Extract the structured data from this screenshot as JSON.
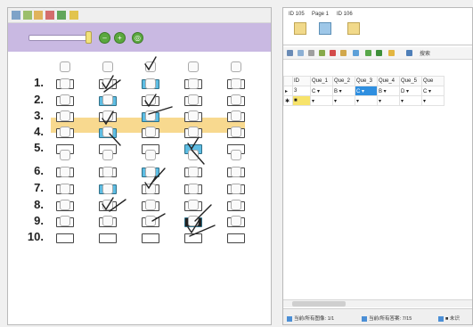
{
  "omr": {
    "questions": [
      "1.",
      "2.",
      "3.",
      "4.",
      "5.",
      "6.",
      "7.",
      "8.",
      "9.",
      "10."
    ]
  },
  "pages": {
    "items": [
      {
        "label": "ID 105"
      },
      {
        "label": "Page 1"
      },
      {
        "label": "ID 106"
      }
    ]
  },
  "grid": {
    "search_label": "搜索",
    "headers": [
      "",
      "ID",
      "Que_1",
      "Que_2",
      "Que_3",
      "Que_4",
      "Que_5",
      "Que"
    ],
    "rows": [
      [
        "▸",
        "3",
        "C  ▾",
        "B  ▾",
        "C  ▾",
        "B  ▾",
        "D  ▾",
        "C  ▾"
      ],
      [
        "✱",
        "■",
        "▾",
        "▾",
        "▾",
        "▾",
        "▾",
        "▾"
      ]
    ]
  },
  "status": {
    "item1": "当前/所有图像: 1/1",
    "item2": "当前/所有答案: 7/15",
    "item3": "■ 未识"
  },
  "colors": {
    "zoom_bar": "#c9b9e2",
    "highlight_row": "#f7d27b",
    "marked_bubble": "#5dbde3",
    "selected_cell": "#2f8fe0"
  }
}
